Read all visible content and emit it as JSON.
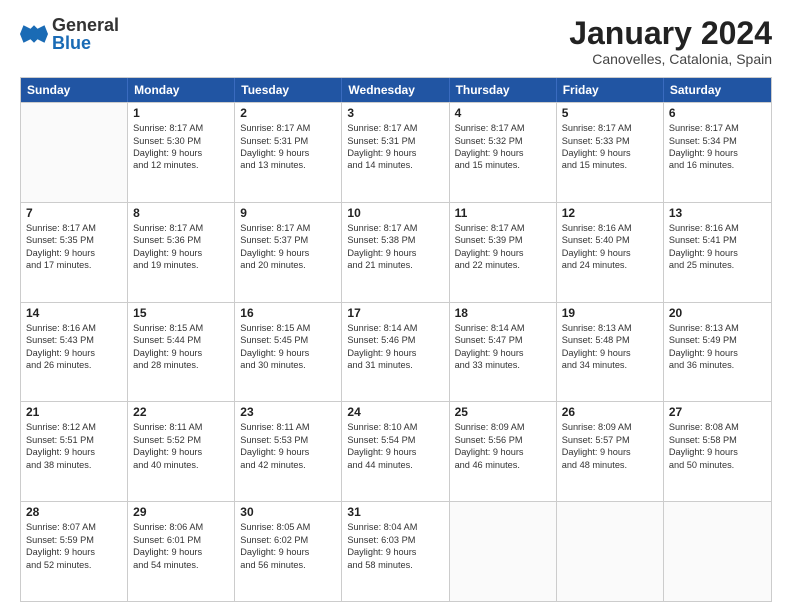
{
  "header": {
    "logo_general": "General",
    "logo_blue": "Blue",
    "month_title": "January 2024",
    "location": "Canovelles, Catalonia, Spain"
  },
  "weekdays": [
    "Sunday",
    "Monday",
    "Tuesday",
    "Wednesday",
    "Thursday",
    "Friday",
    "Saturday"
  ],
  "weeks": [
    [
      {
        "day": "",
        "lines": []
      },
      {
        "day": "1",
        "lines": [
          "Sunrise: 8:17 AM",
          "Sunset: 5:30 PM",
          "Daylight: 9 hours",
          "and 12 minutes."
        ]
      },
      {
        "day": "2",
        "lines": [
          "Sunrise: 8:17 AM",
          "Sunset: 5:31 PM",
          "Daylight: 9 hours",
          "and 13 minutes."
        ]
      },
      {
        "day": "3",
        "lines": [
          "Sunrise: 8:17 AM",
          "Sunset: 5:31 PM",
          "Daylight: 9 hours",
          "and 14 minutes."
        ]
      },
      {
        "day": "4",
        "lines": [
          "Sunrise: 8:17 AM",
          "Sunset: 5:32 PM",
          "Daylight: 9 hours",
          "and 15 minutes."
        ]
      },
      {
        "day": "5",
        "lines": [
          "Sunrise: 8:17 AM",
          "Sunset: 5:33 PM",
          "Daylight: 9 hours",
          "and 15 minutes."
        ]
      },
      {
        "day": "6",
        "lines": [
          "Sunrise: 8:17 AM",
          "Sunset: 5:34 PM",
          "Daylight: 9 hours",
          "and 16 minutes."
        ]
      }
    ],
    [
      {
        "day": "7",
        "lines": [
          "Sunrise: 8:17 AM",
          "Sunset: 5:35 PM",
          "Daylight: 9 hours",
          "and 17 minutes."
        ]
      },
      {
        "day": "8",
        "lines": [
          "Sunrise: 8:17 AM",
          "Sunset: 5:36 PM",
          "Daylight: 9 hours",
          "and 19 minutes."
        ]
      },
      {
        "day": "9",
        "lines": [
          "Sunrise: 8:17 AM",
          "Sunset: 5:37 PM",
          "Daylight: 9 hours",
          "and 20 minutes."
        ]
      },
      {
        "day": "10",
        "lines": [
          "Sunrise: 8:17 AM",
          "Sunset: 5:38 PM",
          "Daylight: 9 hours",
          "and 21 minutes."
        ]
      },
      {
        "day": "11",
        "lines": [
          "Sunrise: 8:17 AM",
          "Sunset: 5:39 PM",
          "Daylight: 9 hours",
          "and 22 minutes."
        ]
      },
      {
        "day": "12",
        "lines": [
          "Sunrise: 8:16 AM",
          "Sunset: 5:40 PM",
          "Daylight: 9 hours",
          "and 24 minutes."
        ]
      },
      {
        "day": "13",
        "lines": [
          "Sunrise: 8:16 AM",
          "Sunset: 5:41 PM",
          "Daylight: 9 hours",
          "and 25 minutes."
        ]
      }
    ],
    [
      {
        "day": "14",
        "lines": [
          "Sunrise: 8:16 AM",
          "Sunset: 5:43 PM",
          "Daylight: 9 hours",
          "and 26 minutes."
        ]
      },
      {
        "day": "15",
        "lines": [
          "Sunrise: 8:15 AM",
          "Sunset: 5:44 PM",
          "Daylight: 9 hours",
          "and 28 minutes."
        ]
      },
      {
        "day": "16",
        "lines": [
          "Sunrise: 8:15 AM",
          "Sunset: 5:45 PM",
          "Daylight: 9 hours",
          "and 30 minutes."
        ]
      },
      {
        "day": "17",
        "lines": [
          "Sunrise: 8:14 AM",
          "Sunset: 5:46 PM",
          "Daylight: 9 hours",
          "and 31 minutes."
        ]
      },
      {
        "day": "18",
        "lines": [
          "Sunrise: 8:14 AM",
          "Sunset: 5:47 PM",
          "Daylight: 9 hours",
          "and 33 minutes."
        ]
      },
      {
        "day": "19",
        "lines": [
          "Sunrise: 8:13 AM",
          "Sunset: 5:48 PM",
          "Daylight: 9 hours",
          "and 34 minutes."
        ]
      },
      {
        "day": "20",
        "lines": [
          "Sunrise: 8:13 AM",
          "Sunset: 5:49 PM",
          "Daylight: 9 hours",
          "and 36 minutes."
        ]
      }
    ],
    [
      {
        "day": "21",
        "lines": [
          "Sunrise: 8:12 AM",
          "Sunset: 5:51 PM",
          "Daylight: 9 hours",
          "and 38 minutes."
        ]
      },
      {
        "day": "22",
        "lines": [
          "Sunrise: 8:11 AM",
          "Sunset: 5:52 PM",
          "Daylight: 9 hours",
          "and 40 minutes."
        ]
      },
      {
        "day": "23",
        "lines": [
          "Sunrise: 8:11 AM",
          "Sunset: 5:53 PM",
          "Daylight: 9 hours",
          "and 42 minutes."
        ]
      },
      {
        "day": "24",
        "lines": [
          "Sunrise: 8:10 AM",
          "Sunset: 5:54 PM",
          "Daylight: 9 hours",
          "and 44 minutes."
        ]
      },
      {
        "day": "25",
        "lines": [
          "Sunrise: 8:09 AM",
          "Sunset: 5:56 PM",
          "Daylight: 9 hours",
          "and 46 minutes."
        ]
      },
      {
        "day": "26",
        "lines": [
          "Sunrise: 8:09 AM",
          "Sunset: 5:57 PM",
          "Daylight: 9 hours",
          "and 48 minutes."
        ]
      },
      {
        "day": "27",
        "lines": [
          "Sunrise: 8:08 AM",
          "Sunset: 5:58 PM",
          "Daylight: 9 hours",
          "and 50 minutes."
        ]
      }
    ],
    [
      {
        "day": "28",
        "lines": [
          "Sunrise: 8:07 AM",
          "Sunset: 5:59 PM",
          "Daylight: 9 hours",
          "and 52 minutes."
        ]
      },
      {
        "day": "29",
        "lines": [
          "Sunrise: 8:06 AM",
          "Sunset: 6:01 PM",
          "Daylight: 9 hours",
          "and 54 minutes."
        ]
      },
      {
        "day": "30",
        "lines": [
          "Sunrise: 8:05 AM",
          "Sunset: 6:02 PM",
          "Daylight: 9 hours",
          "and 56 minutes."
        ]
      },
      {
        "day": "31",
        "lines": [
          "Sunrise: 8:04 AM",
          "Sunset: 6:03 PM",
          "Daylight: 9 hours",
          "and 58 minutes."
        ]
      },
      {
        "day": "",
        "lines": []
      },
      {
        "day": "",
        "lines": []
      },
      {
        "day": "",
        "lines": []
      }
    ]
  ]
}
